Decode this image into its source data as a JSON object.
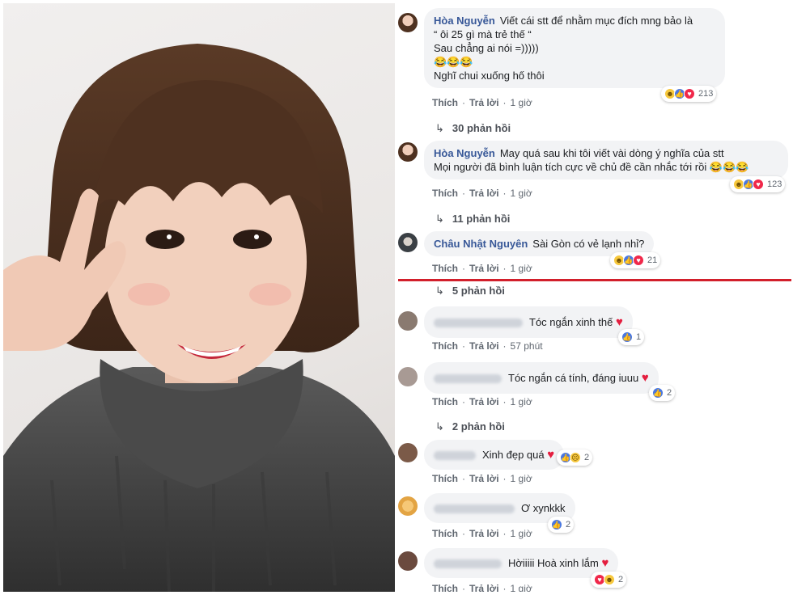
{
  "comments": [
    {
      "name": "Hòa Nguyễn",
      "lines": [
        "Viết cái stt để nhằm mục đích mng bảo là",
        "“ ôi 25 gì mà trẻ thế “",
        "Sau chẳng ai nói =)))))",
        "😂😂😂",
        "Nghĩ chui xuống hố thôi"
      ],
      "like": "Thích",
      "reply": "Trả lời",
      "time": "1 giờ",
      "reaction_count": "213",
      "replies": "30 phản hồi"
    },
    {
      "name": "Hòa Nguyễn",
      "lines": [
        "May quá sau khi tôi viết vài dòng ý nghĩa của stt",
        "Mọi người đã bình luận tích cực về chủ đề cần nhắc tới rồi 😂😂😂"
      ],
      "like": "Thích",
      "reply": "Trả lời",
      "time": "1 giờ",
      "reaction_count": "123",
      "replies": "11 phản hồi"
    },
    {
      "name": "Châu Nhật Nguyên",
      "text": "Sài Gòn có vẻ lạnh nhỉ?",
      "like": "Thích",
      "reply": "Trả lời",
      "time": "1 giờ",
      "reaction_count": "21"
    },
    {
      "replies": "5 phản hồi"
    },
    {
      "text": "Tóc ngắn xinh thế",
      "like": "Thích",
      "reply": "Trả lời",
      "time": "57 phút",
      "reaction_count": "1"
    },
    {
      "text": "Tóc ngắn cá tính, đáng iuuu",
      "like": "Thích",
      "reply": "Trả lời",
      "time": "1 giờ",
      "reaction_count": "2",
      "replies": "2 phản hồi"
    },
    {
      "text": "Xinh đẹp quá",
      "like": "Thích",
      "reply": "Trả lời",
      "time": "1 giờ",
      "reaction_count": "2"
    },
    {
      "text": "Ơ xynkkk",
      "like": "Thích",
      "reply": "Trả lời",
      "time": "1 giờ",
      "reaction_count": "2"
    },
    {
      "text": "Hờiiiii Hoà xinh lắm",
      "like": "Thích",
      "reply": "Trả lời",
      "time": "1 giờ",
      "reaction_count": "2"
    }
  ],
  "icons": {
    "haha": "haha-reaction-icon",
    "like": "like-reaction-icon",
    "love": "love-reaction-icon",
    "sad": "sad-reaction-icon",
    "reply_arrow": "reply-arrow-icon"
  }
}
